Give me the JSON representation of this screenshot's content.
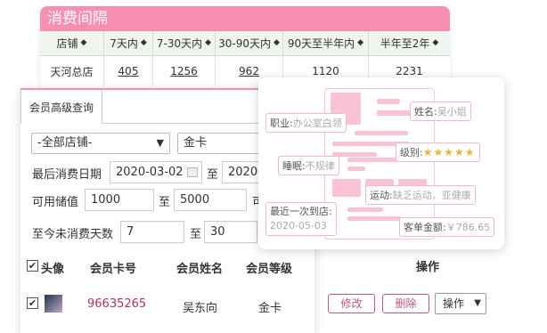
{
  "consume_table": {
    "title": "消费间隔",
    "columns": [
      "店铺",
      "7天内",
      "7-30天内",
      "30-90天内",
      "90天至半年内",
      "半年至2年"
    ],
    "row": [
      "天河总店",
      "405",
      "1256",
      "962",
      "1120",
      "2231"
    ]
  },
  "query_panel": {
    "tab_label": "会员高级查询",
    "store_select": "-全部店铺-",
    "level_select": "金卡",
    "last_consume_label": "最后消费日期",
    "date_from": "2020-03-02",
    "to_label_1": "至",
    "date_to": "2020-0",
    "balance_label": "可用储值",
    "balance_min": "1000",
    "to_label_2": "至",
    "balance_max": "5000",
    "balance_next": "可",
    "days_label": "至今未消费天数",
    "days_min": "7",
    "to_label_3": "至",
    "days_max": "30",
    "list_headers": [
      "头像",
      "会员卡号",
      "会员姓名",
      "会员等级",
      "操作"
    ],
    "member": {
      "card": "96635265",
      "name": "吴东向",
      "level": "金卡"
    },
    "edit_label": "修改",
    "delete_label": "删除",
    "op_label": "操作"
  },
  "profile": {
    "occupation_label": "职业:",
    "occupation": "办公室白领",
    "name_label": "姓名:",
    "name": "吴小姐",
    "level_label": "级别:",
    "stars": "★★★★★",
    "sleep_label": "睡眠:",
    "sleep": "不规律",
    "sport_label": "运动:",
    "sport": "缺乏运动，亚健康",
    "recent_label": "最近一次到店:",
    "recent": "2020-05-03",
    "amount_label": "客单金额:",
    "amount": "￥786.65"
  },
  "colors": {
    "accent": "#f78fb3",
    "link": "#b0325a",
    "button": "#c05a7a"
  }
}
